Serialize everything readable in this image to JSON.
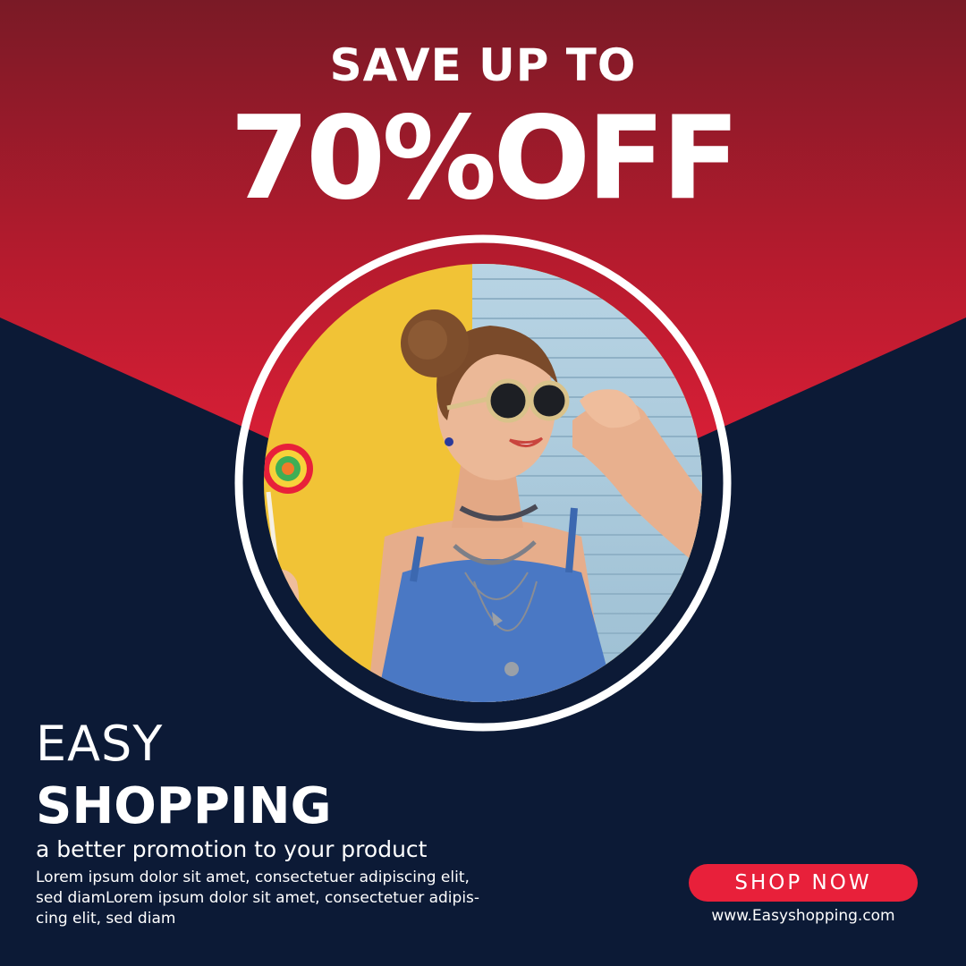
{
  "headline": {
    "save_text": "SAVE UP TO",
    "discount_text": "70%OFF"
  },
  "brand": {
    "line1": "EASY",
    "line2": "SHOPPING",
    "tagline": "a better promotion to your product",
    "body_lines": [
      "Lorem ipsum dolor sit amet, consectetuer adipiscing elit,",
      "sed diamLorem ipsum dolor sit amet, consectetuer adipis-",
      "cing elit, sed diam"
    ]
  },
  "cta": {
    "label": "SHOP NOW",
    "website": "www.Easyshopping.com"
  },
  "colors": {
    "navy_background": "#0c1a36",
    "red_top": "#7a1a26",
    "red_bottom": "#e8203a",
    "button_red": "#e8203a",
    "photo_yellow": "#f4c93a",
    "photo_blue": "#a9c9dc",
    "text_white": "#ffffff"
  },
  "icons": {
    "photo": "woman-with-sunglasses-and-lollipop-photo"
  }
}
